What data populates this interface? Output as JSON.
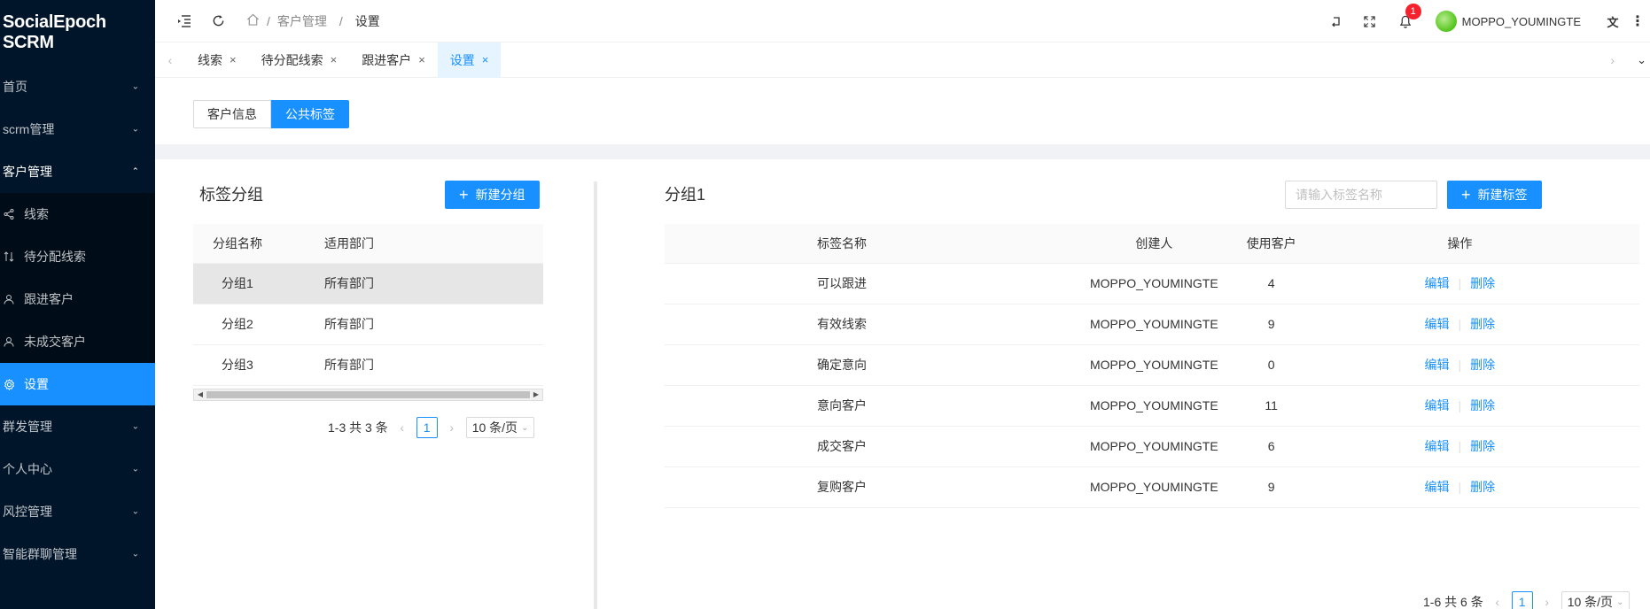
{
  "app": {
    "title": "SocialEpoch SCRM"
  },
  "sidebar": {
    "items": [
      {
        "label": "首页"
      },
      {
        "label": "scrm管理"
      },
      {
        "label": "客户管理"
      },
      {
        "label": "群发管理"
      },
      {
        "label": "个人中心"
      },
      {
        "label": "风控管理"
      },
      {
        "label": "智能群聊管理"
      }
    ],
    "sub_items": [
      {
        "label": "线索",
        "icon": "share-icon"
      },
      {
        "label": "待分配线索",
        "icon": "swap-icon"
      },
      {
        "label": "跟进客户",
        "icon": "user-icon"
      },
      {
        "label": "未成交客户",
        "icon": "user-icon"
      },
      {
        "label": "设置",
        "icon": "gear-icon",
        "active": true
      }
    ]
  },
  "header": {
    "breadcrumb": [
      "客户管理",
      "设置"
    ],
    "notification_count": "1",
    "username": "MOPPO_YOUMINGTE"
  },
  "tabs": [
    {
      "label": "线索"
    },
    {
      "label": "待分配线索"
    },
    {
      "label": "跟进客户"
    },
    {
      "label": "设置",
      "active": true
    }
  ],
  "segments": [
    {
      "label": "客户信息"
    },
    {
      "label": "公共标签",
      "active": true
    }
  ],
  "left_panel": {
    "title": "标签分组",
    "new_button": "新建分组",
    "columns": [
      "分组名称",
      "适用部门"
    ],
    "rows": [
      {
        "name": "分组1",
        "dept": "所有部门",
        "selected": true
      },
      {
        "name": "分组2",
        "dept": "所有部门"
      },
      {
        "name": "分组3",
        "dept": "所有部门"
      }
    ],
    "pagination": {
      "total": "1-3 共 3 条",
      "page": "1",
      "size": "10 条/页"
    }
  },
  "right_panel": {
    "title": "分组1",
    "search_placeholder": "请输入标签名称",
    "new_button": "新建标签",
    "columns": [
      "标签名称",
      "创建人",
      "使用客户",
      "操作"
    ],
    "edit_label": "编辑",
    "delete_label": "删除",
    "rows": [
      {
        "name": "可以跟进",
        "creator": "MOPPO_YOUMINGTE",
        "count": "4"
      },
      {
        "name": "有效线索",
        "creator": "MOPPO_YOUMINGTE",
        "count": "9"
      },
      {
        "name": "确定意向",
        "creator": "MOPPO_YOUMINGTE",
        "count": "0"
      },
      {
        "name": "意向客户",
        "creator": "MOPPO_YOUMINGTE",
        "count": "11"
      },
      {
        "name": "成交客户",
        "creator": "MOPPO_YOUMINGTE",
        "count": "6"
      },
      {
        "name": "复购客户",
        "creator": "MOPPO_YOUMINGTE",
        "count": "9"
      }
    ],
    "pagination": {
      "total": "1-6 共 6 条",
      "page": "1",
      "size": "10 条/页"
    }
  },
  "colors": {
    "primary": "#1890ff",
    "sidebar_bg": "#001529",
    "badge": "#f5222d"
  }
}
